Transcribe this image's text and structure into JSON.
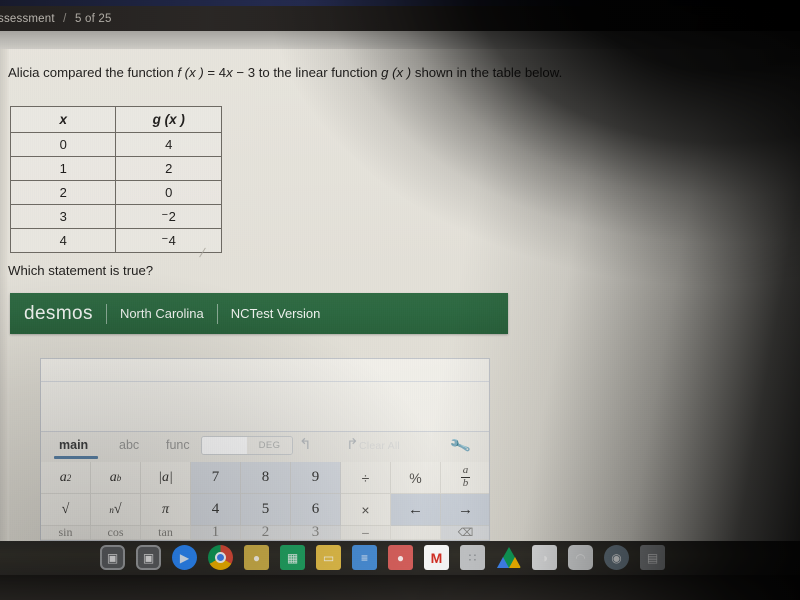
{
  "window": {
    "appbar_title": "ssessment",
    "appbar_separator": "/",
    "appbar_progress": "5 of 25"
  },
  "question": {
    "prefix": "Alicia compared the function ",
    "function_f": "f (x )",
    "equals": " = 4",
    "var_x": "x",
    "rest": " − 3 to the linear function ",
    "function_g": "g (x )",
    "suffix": " shown in the table below.",
    "prompt": "Which statement is true?"
  },
  "table": {
    "headers": [
      "x",
      "g (x )"
    ],
    "rows": [
      {
        "x": "0",
        "g": "4",
        "g_negative": false
      },
      {
        "x": "1",
        "g": "2",
        "g_negative": false
      },
      {
        "x": "2",
        "g": "0",
        "g_negative": false
      },
      {
        "x": "3",
        "g": "2",
        "g_negative": true
      },
      {
        "x": "4",
        "g": "4",
        "g_negative": true
      }
    ]
  },
  "desmos_bar": {
    "logo": "desmos",
    "region": "North Carolina",
    "version": "NCTest Version",
    "background_color": "#2c6840"
  },
  "calculator": {
    "tabs": [
      {
        "label": "main",
        "active": true
      },
      {
        "label": "abc",
        "active": false
      },
      {
        "label": "func",
        "active": false
      }
    ],
    "angle_mode": {
      "left": "RAD",
      "right": "DEG",
      "selected": "DEG"
    },
    "undo_icon": "undo-arrow-icon",
    "redo_icon": "redo-arrow-icon",
    "clear_all_label": "Clear All",
    "settings_icon": "wrench-icon",
    "keys_row1": [
      "a²",
      "aᵇ",
      "|a|",
      "7",
      "8",
      "9",
      "÷",
      "%",
      "a/b"
    ],
    "keys_row2": [
      "√",
      "ⁿ√",
      "π",
      "4",
      "5",
      "6",
      "×",
      "←",
      "→"
    ],
    "keys_row3": [
      "sin",
      "cos",
      "tan",
      "1",
      "2",
      "3",
      "−",
      "",
      "⌫"
    ],
    "accent_color": "#5b83a8"
  },
  "shelf": {
    "icons": [
      {
        "name": "app-tile-1",
        "glyph": "▣",
        "color": "#5d5f62",
        "shape": "tile",
        "active": true
      },
      {
        "name": "app-tile-2",
        "glyph": "▣",
        "color": "#5d5f62",
        "shape": "tile",
        "active": false
      },
      {
        "name": "zoom-icon",
        "glyph": "▶",
        "color": "#2d8cff",
        "shape": "round",
        "active": false
      },
      {
        "name": "chrome-icon",
        "glyph": "",
        "color": "#dd4b39",
        "shape": "round",
        "active": true
      },
      {
        "name": "google-classroom-icon",
        "glyph": "●",
        "color": "#d0b24a",
        "shape": "doc",
        "active": false
      },
      {
        "name": "google-sheets-icon",
        "glyph": "▦",
        "color": "#22a463",
        "shape": "doc",
        "active": false
      },
      {
        "name": "google-slides-icon",
        "glyph": "▭",
        "color": "#e5c04a",
        "shape": "doc",
        "active": false
      },
      {
        "name": "google-docs-icon",
        "glyph": "≡",
        "color": "#4a90d9",
        "shape": "doc",
        "active": false
      },
      {
        "name": "pdf-tool-icon",
        "glyph": "●",
        "color": "#d9615d",
        "shape": "doc",
        "active": false
      },
      {
        "name": "gmail-icon",
        "glyph": "M",
        "color": "#ffffff",
        "shape": "doc",
        "active": false
      },
      {
        "name": "app-launcher-icon",
        "glyph": "∷",
        "color": "#c7c9cb",
        "shape": "doc",
        "active": false
      },
      {
        "name": "google-drive-icon",
        "glyph": "▲",
        "color": "#3d8f4a",
        "shape": "plain",
        "active": false
      },
      {
        "name": "app-circle-icon",
        "glyph": "◑",
        "color": "#e8e9ea",
        "shape": "doc",
        "active": false
      },
      {
        "name": "whale-app-icon",
        "glyph": "◠",
        "color": "#dfe1e2",
        "shape": "plain",
        "active": false
      },
      {
        "name": "camera-icon",
        "glyph": "◉",
        "color": "#6a7a86",
        "shape": "round",
        "active": false
      },
      {
        "name": "edge-app-icon",
        "glyph": "▤",
        "color": "#8a8d90",
        "shape": "doc",
        "active": false
      }
    ]
  }
}
